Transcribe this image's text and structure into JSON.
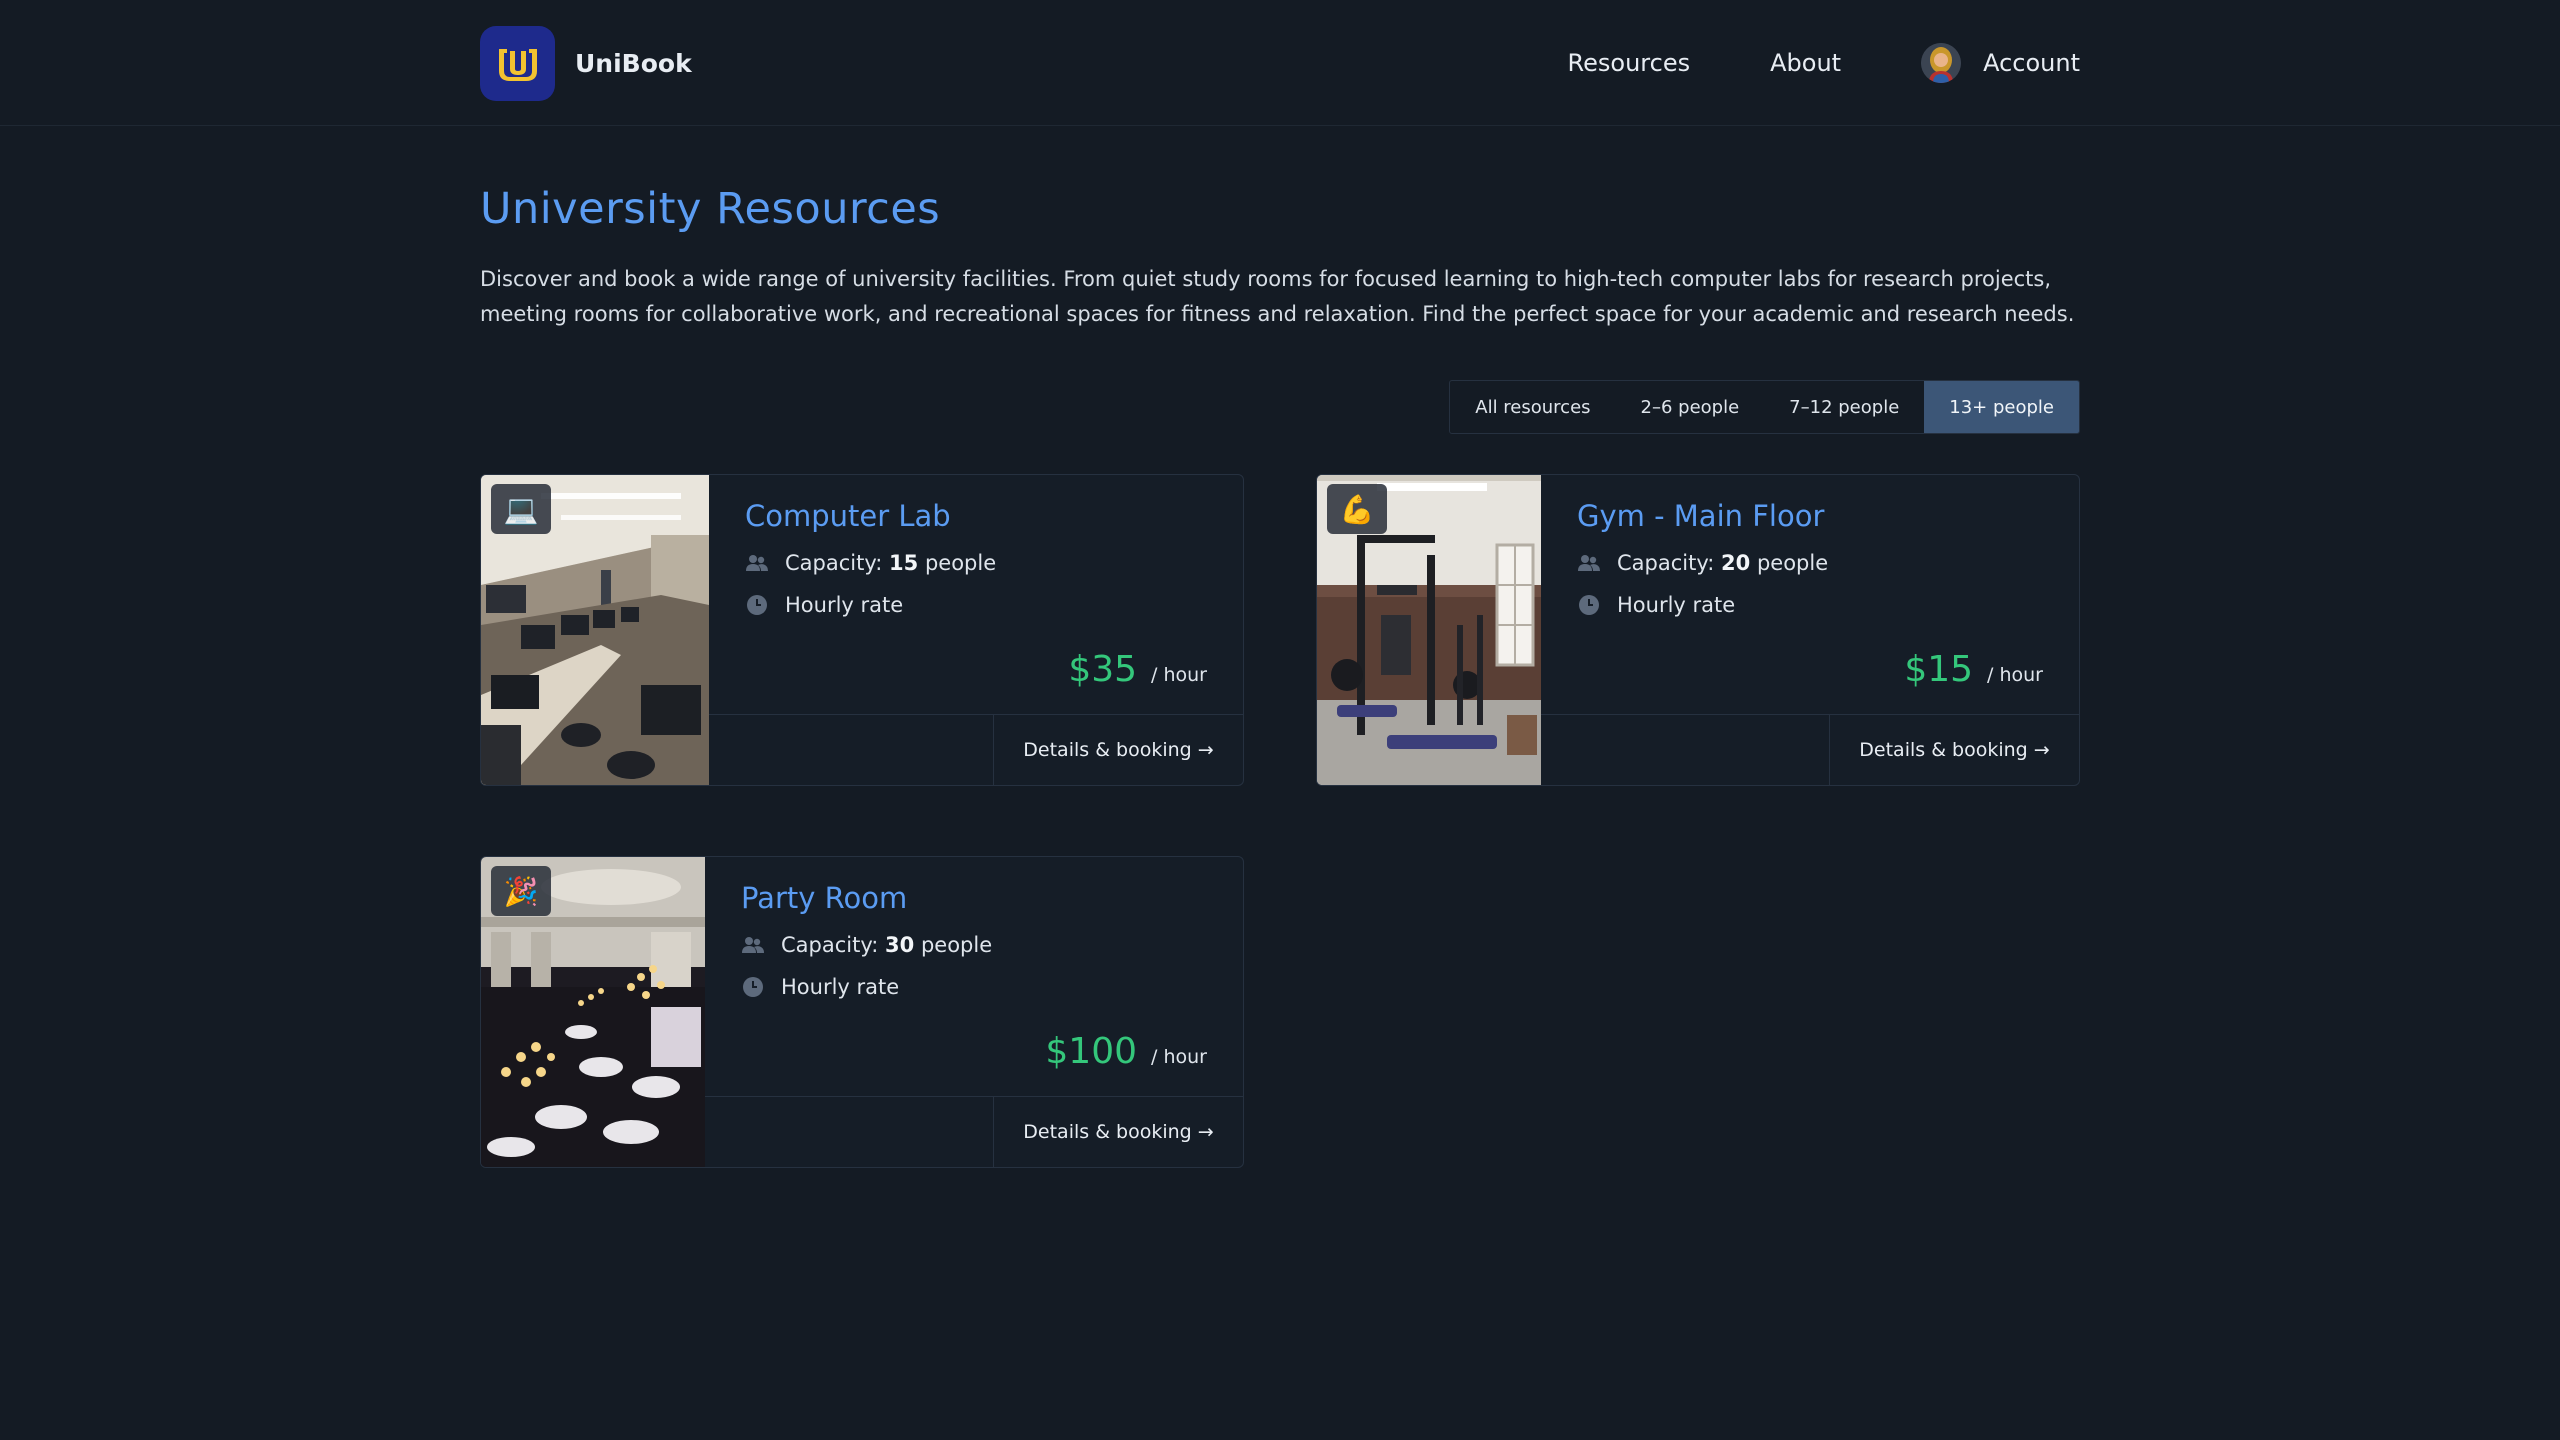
{
  "header": {
    "brand_name": "UniBook",
    "nav": [
      {
        "label": "Resources"
      },
      {
        "label": "About"
      }
    ],
    "account_label": "Account"
  },
  "main": {
    "title": "University Resources",
    "intro": "Discover and book a wide range of university facilities. From quiet study rooms for focused learning to high-tech computer labs for research projects, meeting rooms for collaborative work, and recreational spaces for fitness and relaxation. Find the perfect space for your academic and research needs.",
    "filters": [
      {
        "label": "All resources",
        "active": false
      },
      {
        "label": "2–6 people",
        "active": false
      },
      {
        "label": "7–12 people",
        "active": false
      },
      {
        "label": "13+ people",
        "active": true
      }
    ],
    "resources": [
      {
        "name": "Computer Lab",
        "emoji": "💻",
        "capacity_prefix": "Capacity:",
        "capacity": "15",
        "capacity_suffix": "people",
        "rate_label": "Hourly rate",
        "price": "$35",
        "price_unit": "/ hour",
        "action": "Details & booking →"
      },
      {
        "name": "Gym - Main Floor",
        "emoji": "💪",
        "capacity_prefix": "Capacity:",
        "capacity": "20",
        "capacity_suffix": "people",
        "rate_label": "Hourly rate",
        "price": "$15",
        "price_unit": "/ hour",
        "action": "Details & booking →"
      },
      {
        "name": "Party Room",
        "emoji": "🎉",
        "capacity_prefix": "Capacity:",
        "capacity": "30",
        "capacity_suffix": "people",
        "rate_label": "Hourly rate",
        "price": "$100",
        "price_unit": "/ hour",
        "action": "Details & booking →"
      }
    ]
  },
  "colors": {
    "background": "#141b24",
    "accent": "#5b9cf2",
    "price": "#34c77b",
    "active_filter": "#3c5677",
    "logo_bg": "#1e2a8c",
    "logo_fg": "#f2c230"
  },
  "icons": {
    "capacity": "people-icon",
    "rate": "clock-icon"
  }
}
